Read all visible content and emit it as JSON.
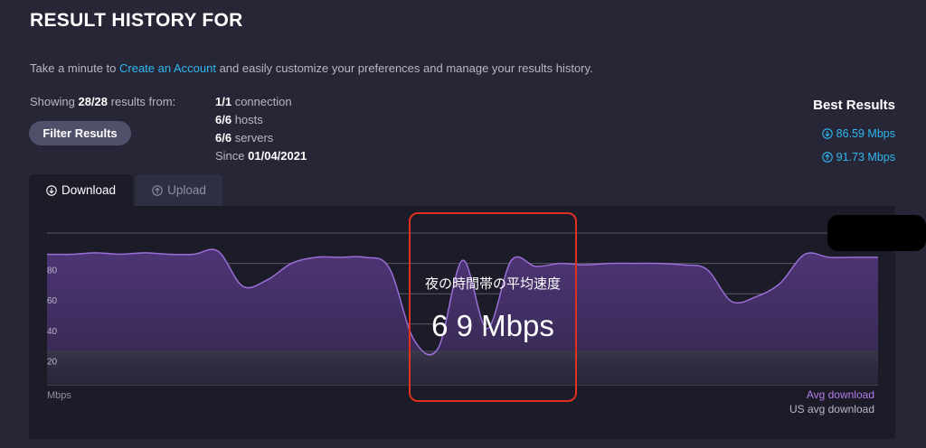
{
  "header": {
    "title": "RESULT HISTORY FOR",
    "intro_before": "Take a minute to ",
    "intro_link": "Create an Account",
    "intro_after": " and easily customize your preferences and manage your results history."
  },
  "filter": {
    "showing_label": "Showing ",
    "showing_count": "28/28",
    "showing_suffix": " results from:",
    "button_label": "Filter Results"
  },
  "stats": [
    {
      "value": "1/1",
      "label": " connection"
    },
    {
      "value": "6/6",
      "label": " hosts"
    },
    {
      "value": "6/6",
      "label": " servers"
    },
    {
      "label": "Since ",
      "value": "01/04/2021"
    }
  ],
  "best_results": {
    "heading": "Best Results",
    "download": "86.59 Mbps",
    "upload": "91.73 Mbps"
  },
  "tabs": {
    "download": "Download",
    "upload": "Upload"
  },
  "chart_data": {
    "type": "area",
    "ylabel": "Mbps",
    "y_ticks": [
      "80",
      "60",
      "40",
      "20"
    ],
    "ylim": [
      0,
      100
    ],
    "legend": [
      "Avg download",
      "US avg download"
    ],
    "series": [
      {
        "name": "Avg download",
        "values": [
          86,
          86,
          87,
          86,
          87,
          86,
          86,
          88,
          65,
          69,
          80,
          84,
          84,
          84,
          77,
          30,
          24,
          82,
          37,
          82,
          78,
          80,
          79,
          80,
          80,
          80,
          79,
          76,
          55,
          58,
          67,
          86,
          84,
          84,
          84
        ]
      }
    ],
    "colors": {
      "series": "#9a6ed6",
      "fill": "#4a3370"
    }
  },
  "annotation": {
    "title": "夜の時間帯の平均速度",
    "value": "6 9 Mbps"
  }
}
